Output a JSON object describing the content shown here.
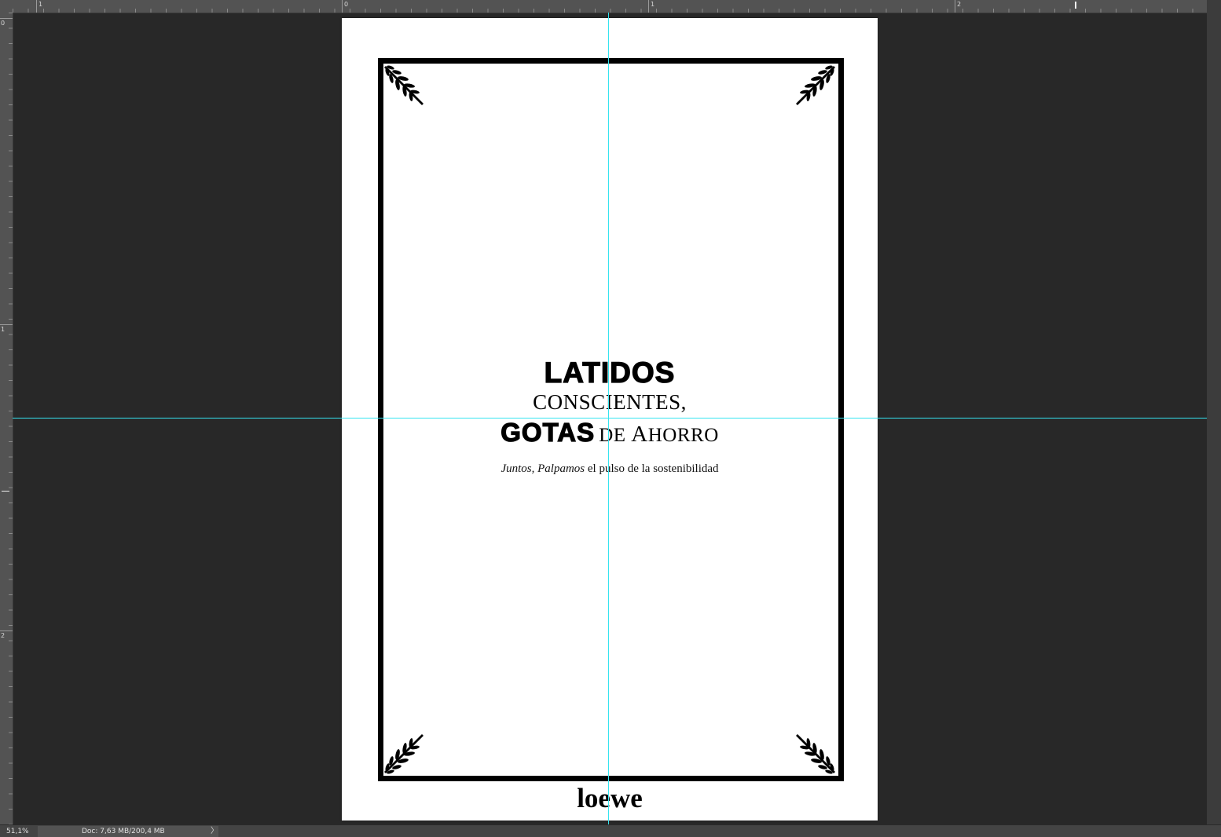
{
  "rulers": {
    "top_labels": [
      "1",
      "0",
      "1",
      "2"
    ],
    "left_labels": [
      "0",
      "1",
      "2"
    ]
  },
  "status": {
    "zoom": "51,1%",
    "doc": "Doc: 7,63 MB/200,4 MB",
    "arrow": "〉"
  },
  "poster": {
    "title_line1": "LATIDOS",
    "title_line2": "CONSCIENTES,",
    "title_line3_bold": "GOTAS",
    "title_line3_de": "DE ",
    "title_line3_a": "A",
    "title_line3_rest": "HORRO",
    "subtitle_italic": "Juntos, Palpamos",
    "subtitle_rest": " el pulso de la sostenibilidad",
    "brand": "loewe"
  },
  "colors": {
    "guide": "#35e4f0",
    "workspace": "#282828",
    "ruler": "#535353"
  }
}
